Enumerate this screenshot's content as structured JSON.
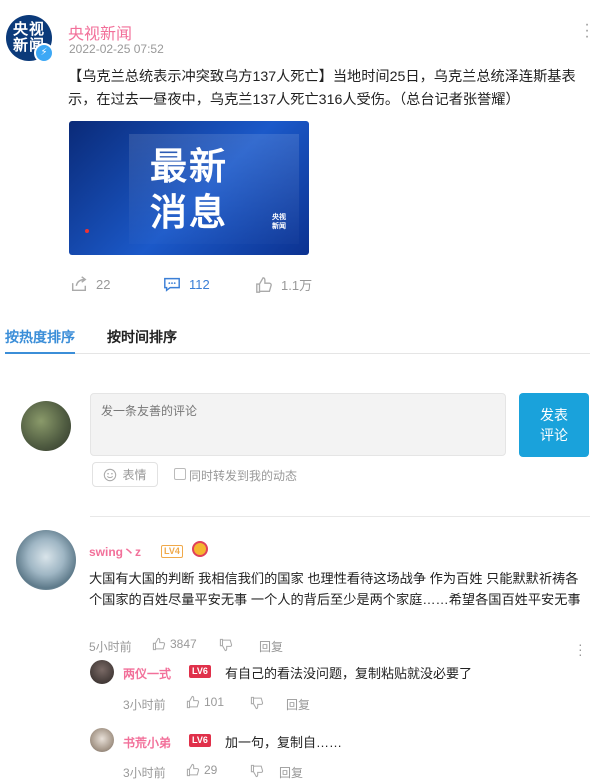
{
  "account": {
    "avatar_lines": [
      "央视",
      "新闻"
    ],
    "name": "央视新闻",
    "time": "2022-02-25 07:52"
  },
  "post": {
    "text": "【乌克兰总统表示冲突致乌方137人死亡】当地时间25日，乌克兰总统泽连斯基表示，在过去一昼夜中，乌克兰137人死亡316人受伤。（总台记者张誉耀）",
    "image": {
      "lines": [
        "最新",
        "消息"
      ],
      "logo": [
        "央视",
        "新闻"
      ]
    },
    "stats": {
      "share": "22",
      "comments": "112",
      "likes": "1.1万"
    }
  },
  "tabs": {
    "hot": "按热度排序",
    "time": "按时间排序"
  },
  "composer": {
    "placeholder": "发一条友善的评论",
    "submit": "发表\n评论",
    "emoji_label": "表情",
    "forward_label": "同时转发到我的动态"
  },
  "comments": [
    {
      "user": "swing丶z",
      "level": "LV4",
      "text": "大国有大国的判断 我相信我们的国家 也理性看待这场战争 作为百姓 只能默默祈祷各个国家的百姓尽量平安无事 一个人的背后至少是两个家庭……希望各国百姓平安无事",
      "time": "5小时前",
      "likes": "3847",
      "reply_label": "回复",
      "replies": [
        {
          "user": "两仪一式",
          "level": "LV6",
          "text": "有自己的看法没问题，复制粘贴就没必要了",
          "time": "3小时前",
          "likes": "101",
          "reply_label": "回复"
        },
        {
          "user": "书荒小弟",
          "level": "LV6",
          "text": "加一句，复制自……",
          "time": "3小时前",
          "likes": "29",
          "reply_label": "回复"
        }
      ]
    }
  ],
  "colors": {
    "accent": "#3b8ed8",
    "username": "#f2709a",
    "button": "#1aa2db"
  }
}
